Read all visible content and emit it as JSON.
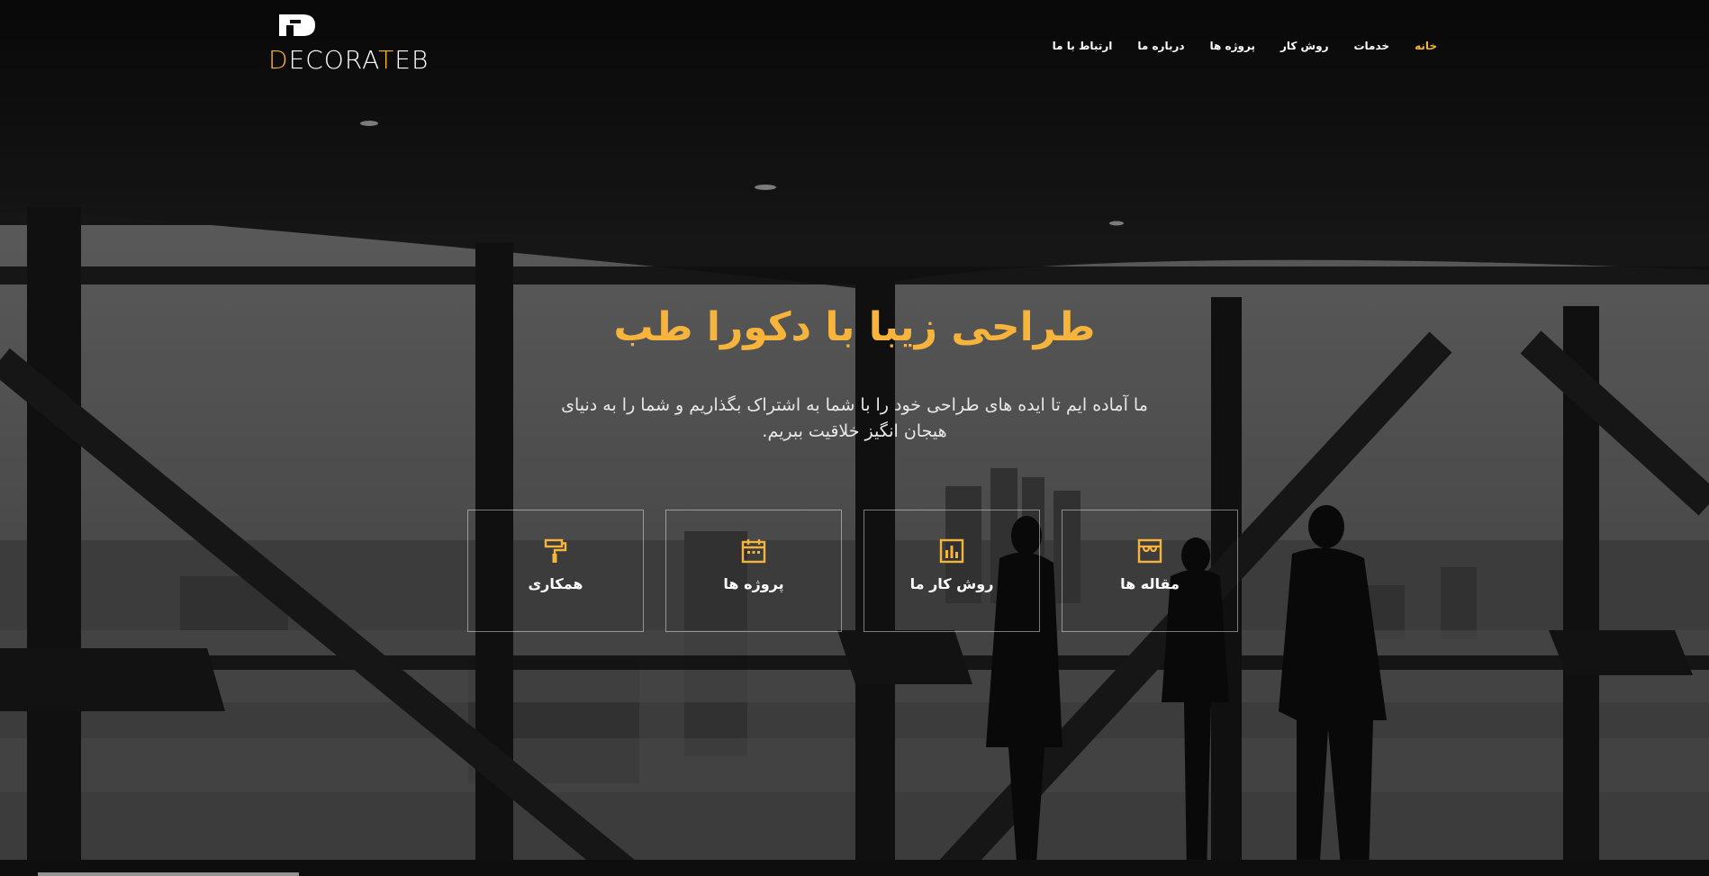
{
  "brand": {
    "logo_text_parts": [
      {
        "text": "D",
        "accent": true
      },
      {
        "text": "ECORA",
        "accent": false
      },
      {
        "text": "T",
        "accent": true
      },
      {
        "text": "EB",
        "accent": false
      }
    ],
    "logo_icon": "decorateb-logo-icon"
  },
  "nav": {
    "items": [
      {
        "label": "خانه",
        "active": true
      },
      {
        "label": "خدمات",
        "active": false
      },
      {
        "label": "روش کار",
        "active": false
      },
      {
        "label": "پروژه ها",
        "active": false
      },
      {
        "label": "درباره ما",
        "active": false
      },
      {
        "label": "ارتباط با ما",
        "active": false
      }
    ]
  },
  "hero": {
    "title": "طراحی زیبا با دکورا طب",
    "subtitle": "ما آماده ایم تا ایده های طراحی خود را با شما به اشتراک بگذاریم و شما را به دنیای هیجان انگیز خلاقیت ببریم."
  },
  "cards": [
    {
      "label": "مقاله ها",
      "icon": "store-icon"
    },
    {
      "label": "روش کار ما",
      "icon": "bar-chart-icon"
    },
    {
      "label": "پروژه ها",
      "icon": "calendar-icon"
    },
    {
      "label": "همکاری",
      "icon": "paint-roller-icon"
    }
  ],
  "colors": {
    "accent": "#f6b43c",
    "text": "#ffffff"
  }
}
